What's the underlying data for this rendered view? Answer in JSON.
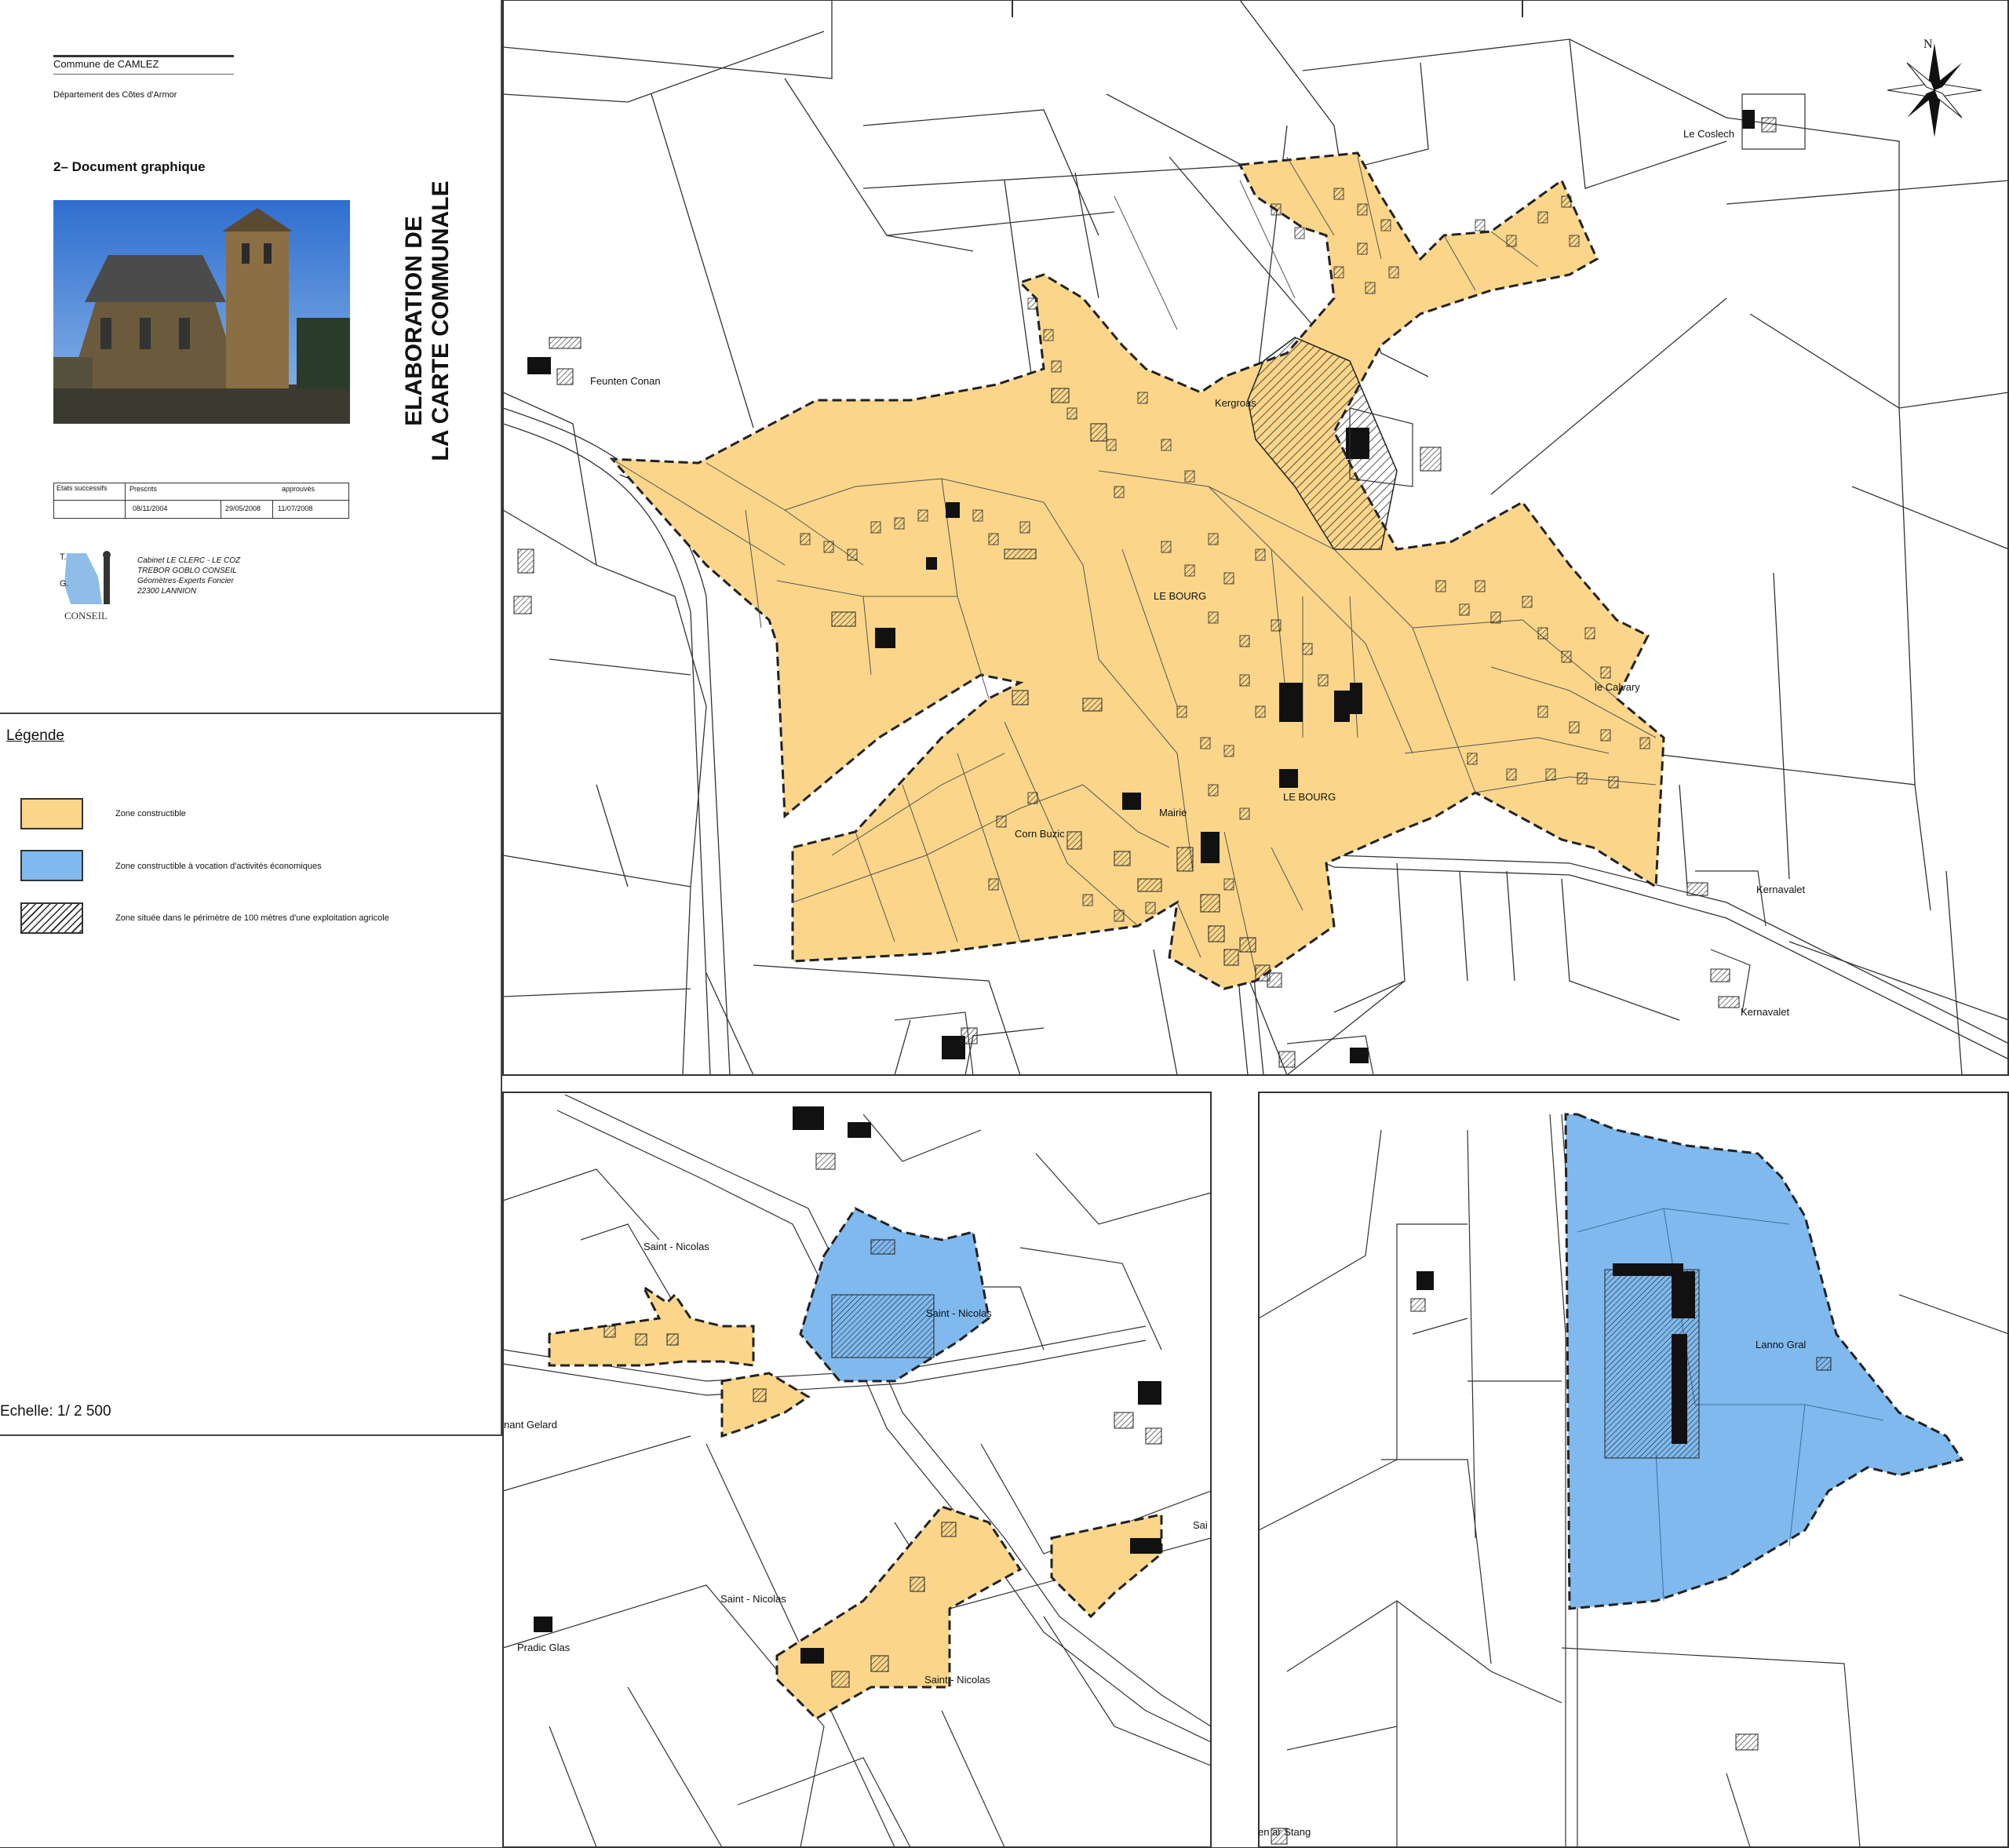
{
  "title_block": {
    "commune": "Commune de CAMLEZ",
    "department": "Département des Côtes d'Armor",
    "document": "2– Document graphique",
    "vertical_title_line1": "ELABORATION DE",
    "vertical_title_line2": "LA CARTE COMMUNALE",
    "status_table": {
      "headers": [
        "Etats successifs",
        "Prescrits",
        "approuvés",
        ""
      ],
      "dates": [
        "",
        "08/11/2004",
        "29/05/2008",
        "11/07/2008"
      ]
    },
    "company": {
      "logo_text": "CONSEIL",
      "lines": [
        "Cabinet LE CLERC - LE COZ",
        "TREBOR GOBLO CONSEIL",
        "Géomètres-Experts Foncier",
        "22300 LANNION"
      ]
    }
  },
  "legend": {
    "title": "Légende",
    "items": [
      {
        "label": "Zone constructible",
        "color": "#fbd68a"
      },
      {
        "label": "Zone constructible à vocation d'activités économiques",
        "color": "#7fb9ee"
      },
      {
        "label": "Zone située dans le périmètre de 100 mètres d'une exploitation agricole",
        "color": "hatch"
      }
    ],
    "scale": "Echelle: 1/ 2 500"
  },
  "maps": {
    "north_label": "N",
    "main_places": [
      "Feunten Conan",
      "Kergroas",
      "Le Coslech",
      "LE BOURG",
      "LE BOURG",
      "le Calvary",
      "Mairie",
      "Corn Buzic",
      "Kernavalet",
      "Kernavalet"
    ],
    "left_inset_places": [
      "Saint - Nicolas",
      "Saint - Nicolas",
      "Saint - Nicolas",
      "Saint - Nicolas",
      "nant Gelard",
      "Pradic Glas",
      "Sai"
    ],
    "right_inset_places": [
      "Lanno Gral",
      "en ar Stang"
    ]
  },
  "colors": {
    "constructible": "#fbd68a",
    "economic": "#7fb9ee",
    "outline": "#222222"
  }
}
